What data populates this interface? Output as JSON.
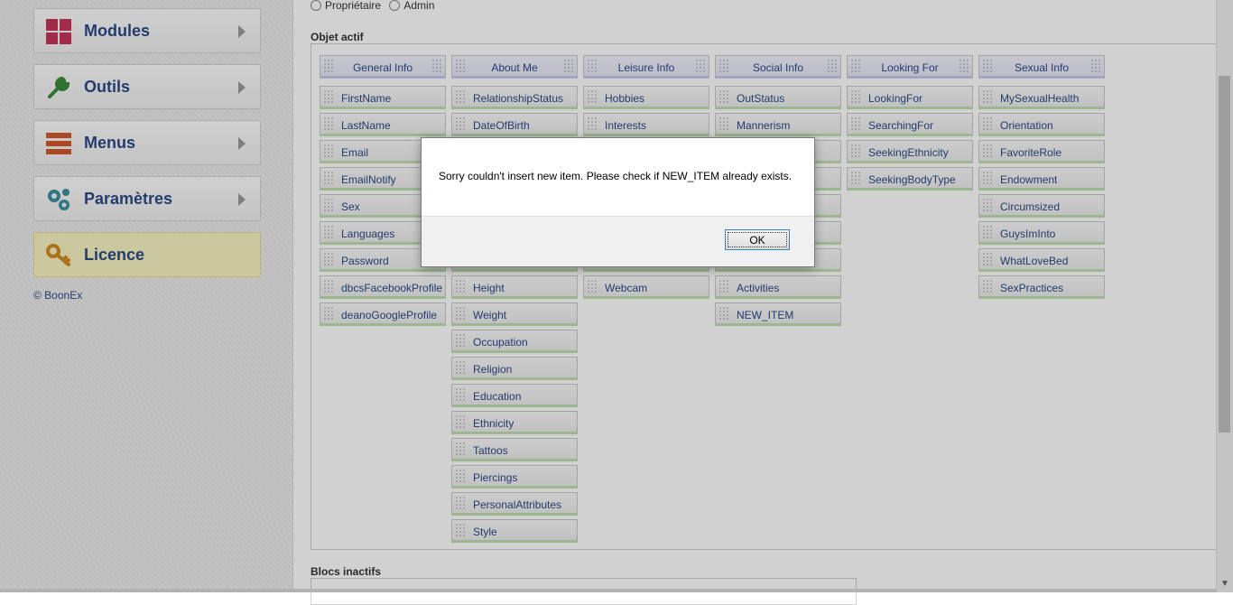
{
  "sidebar": {
    "items": [
      {
        "label": "Modules",
        "icon": "grid-icon"
      },
      {
        "label": "Outils",
        "icon": "wrench-icon"
      },
      {
        "label": "Menus",
        "icon": "menu-icon"
      },
      {
        "label": "Paramètres",
        "icon": "gears-icon"
      },
      {
        "label": "Licence",
        "icon": "key-icon"
      }
    ],
    "copyright": "© BoonEx"
  },
  "main": {
    "radio_owner": "Propriétaire",
    "radio_admin": "Admin",
    "active_title": "Objet actif",
    "inactive_title": "Blocs inactifs",
    "columns": [
      {
        "header": "General Info",
        "items": [
          "FirstName",
          "LastName",
          "Email",
          "EmailNotify",
          "Sex",
          "Languages",
          "Password",
          "dbcsFacebookProfile",
          "deanoGoogleProfile"
        ]
      },
      {
        "header": "About Me",
        "items": [
          "RelationshipStatus",
          "DateOfBirth",
          "",
          "",
          "",
          "",
          "",
          "Height",
          "Weight",
          "Occupation",
          "Religion",
          "Education",
          "Ethnicity",
          "Tattoos",
          "Piercings",
          "PersonalAttributes",
          "Style"
        ]
      },
      {
        "header": "Leisure Info",
        "items": [
          "Hobbies",
          "Interests",
          "",
          "",
          "",
          "",
          "",
          "Webcam"
        ]
      },
      {
        "header": "Social Info",
        "items": [
          "OutStatus",
          "Mannerism",
          "",
          "",
          "",
          "",
          "",
          "Activities",
          "NEW_ITEM"
        ]
      },
      {
        "header": "Looking For",
        "items": [
          "LookingFor",
          "SearchingFor",
          "SeekingEthnicity",
          "SeekingBodyType"
        ]
      },
      {
        "header": "Sexual Info",
        "items": [
          "MySexualHealth",
          "Orientation",
          "FavoriteRole",
          "Endowment",
          "Circumsized",
          "GuysImInto",
          "WhatLoveBed",
          "SexPractices"
        ]
      }
    ]
  },
  "dialog": {
    "message": "Sorry couldn't insert new item. Please check if NEW_ITEM already exists.",
    "ok_label": "OK"
  }
}
